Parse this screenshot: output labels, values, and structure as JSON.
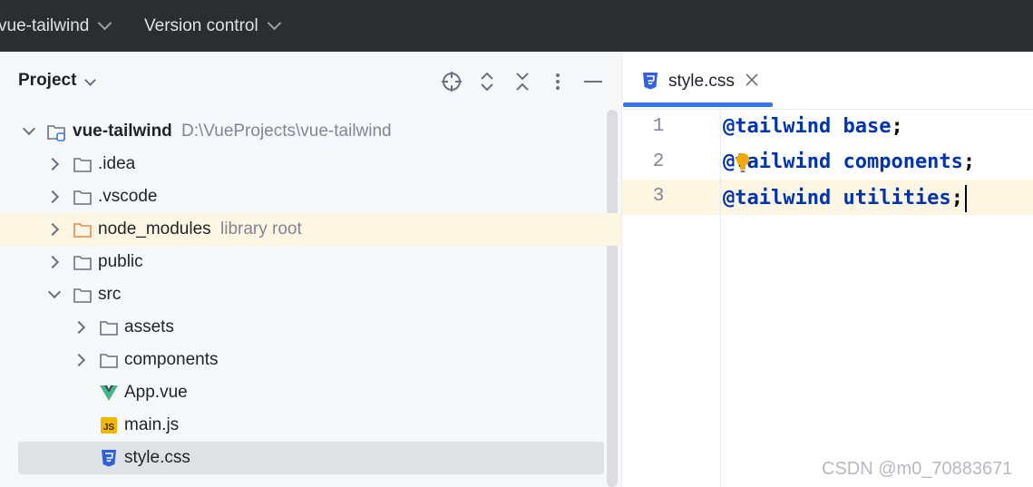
{
  "topbar": {
    "project_label": "vue-tailwind",
    "vcs_label": "Version control"
  },
  "project_panel": {
    "title": "Project",
    "toolbar_icons": [
      "crosshair-icon",
      "expand-all-icon",
      "collapse-all-icon",
      "more-icon",
      "minimize-icon"
    ],
    "tree": {
      "root": {
        "name": "vue-tailwind",
        "path": "D:\\VueProjects\\vue-tailwind"
      },
      "items": [
        {
          "name": ".idea"
        },
        {
          "name": ".vscode"
        },
        {
          "name": "node_modules",
          "hint": "library root"
        },
        {
          "name": "public"
        },
        {
          "name": "src"
        },
        {
          "name": "assets"
        },
        {
          "name": "components"
        },
        {
          "name": "App.vue"
        },
        {
          "name": "main.js"
        },
        {
          "name": "style.css"
        }
      ]
    }
  },
  "editor": {
    "tab_label": "style.css",
    "lines": [
      {
        "number": "1",
        "keyword": "@tailwind",
        "arg": "base"
      },
      {
        "number": "2",
        "keyword": "@tailwind",
        "arg": "components"
      },
      {
        "number": "3",
        "keyword": "@tailwind",
        "arg": "utilities"
      }
    ],
    "semicolon": ";"
  },
  "colors": {
    "keyword": "#0033b3",
    "accent": "#3574f0",
    "highlight_row": "#fdf6e2",
    "vue_green": "#41b883",
    "js_yellow": "#f4b400",
    "css_blue": "#2f5fe0"
  },
  "watermark": "CSDN @m0_70883671"
}
